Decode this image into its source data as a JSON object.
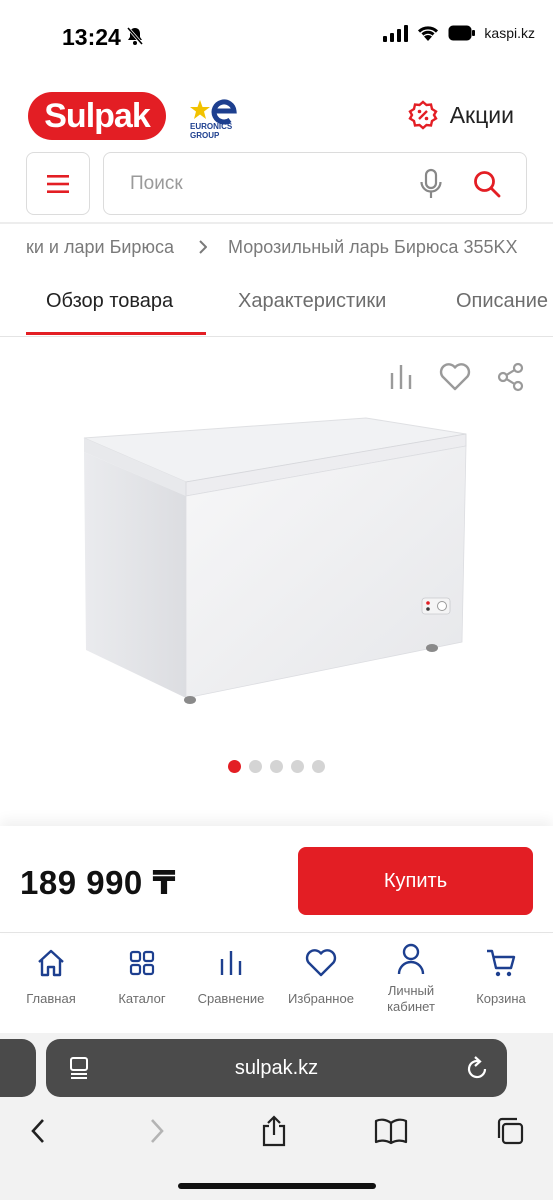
{
  "status_bar": {
    "time": "13:24",
    "watermark": "kaspi.kz"
  },
  "header": {
    "logo_text": "Sulpak",
    "partner_logo_text": "EURONICS GROUP",
    "promo_label": "Акции"
  },
  "search": {
    "placeholder": "Поиск",
    "value": ""
  },
  "breadcrumbs": [
    "ки и лари Бирюса",
    "Морозильный ларь Бирюса 355KX"
  ],
  "tabs": [
    {
      "label": "Обзор товара",
      "active": true
    },
    {
      "label": "Характеристики",
      "active": false
    },
    {
      "label": "Описание",
      "active": false
    }
  ],
  "gallery": {
    "total_images": 5,
    "current_image": 1
  },
  "purchase": {
    "price": "189 990 ₸",
    "buy_label": "Купить"
  },
  "bottom_nav": [
    {
      "label": "Главная",
      "icon": "home-icon"
    },
    {
      "label": "Каталог",
      "icon": "catalog-icon"
    },
    {
      "label": "Сравнение",
      "icon": "compare-icon"
    },
    {
      "label": "Избранное",
      "icon": "heart-icon"
    },
    {
      "label": "Личный кабинет",
      "icon": "user-icon"
    },
    {
      "label": "Корзина",
      "icon": "cart-icon"
    }
  ],
  "browser": {
    "url": "sulpak.kz"
  },
  "colors": {
    "brand": "#e31e24",
    "euronics_blue": "#1d3f8f",
    "euronics_yellow": "#f2c200"
  }
}
